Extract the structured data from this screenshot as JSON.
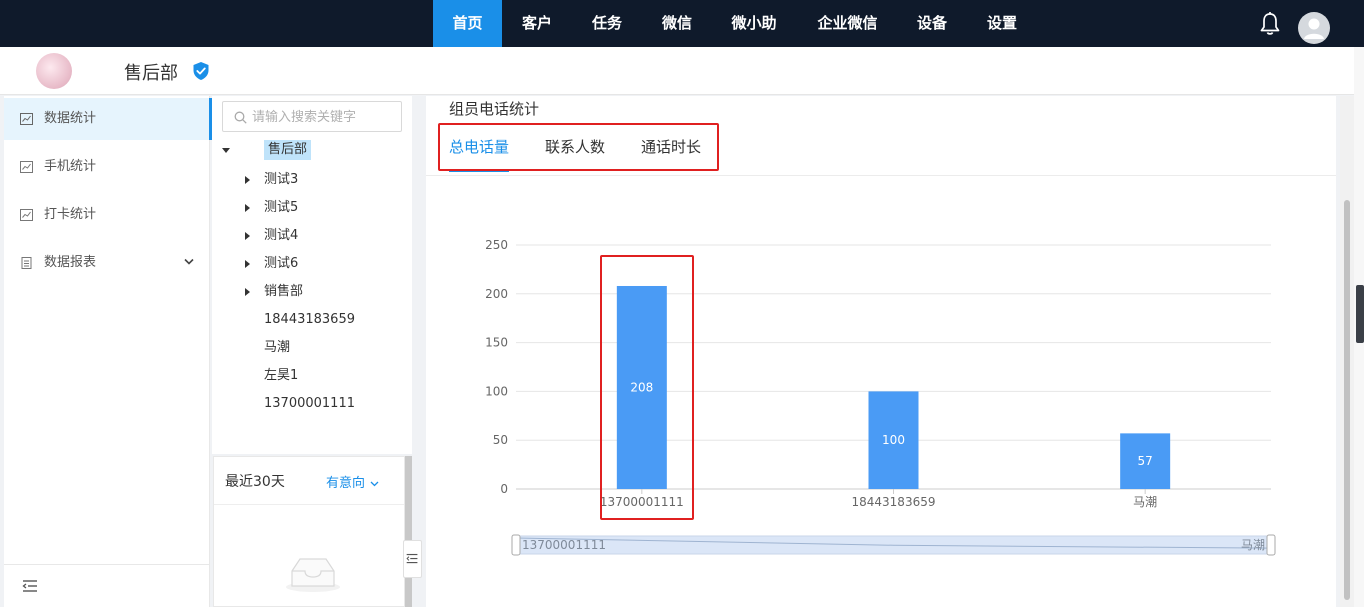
{
  "topnav": {
    "items": [
      "首页",
      "客户",
      "任务",
      "微信",
      "微小助",
      "企业微信",
      "设备",
      "设置"
    ],
    "active_index": 0,
    "accent": "#1a8fe8",
    "background": "#0f1a2b"
  },
  "org": {
    "name": "售后部",
    "verified_icon": "shield-check-icon"
  },
  "leftmenu": {
    "items": [
      {
        "label": "数据统计",
        "icon": "chart-icon",
        "active": true
      },
      {
        "label": "手机统计",
        "icon": "chart-icon",
        "active": false
      },
      {
        "label": "打卡统计",
        "icon": "chart-icon",
        "active": false
      },
      {
        "label": "数据报表",
        "icon": "table-icon",
        "active": false,
        "expandable": true
      }
    ]
  },
  "tree": {
    "search_placeholder": "请输入搜索关键字",
    "root": "售后部",
    "children": [
      "测试3",
      "测试5",
      "测试4",
      "测试6",
      "销售部"
    ],
    "members": [
      "18443183659",
      "马潮",
      "左昊1",
      "13700001111"
    ]
  },
  "recent": {
    "title": "最近30天",
    "filter": "有意向"
  },
  "main": {
    "title": "组员电话统计",
    "tabs": [
      "总电话量",
      "联系人数",
      "通话时长"
    ],
    "active_tab": 0
  },
  "chart_data": {
    "type": "bar",
    "title": "",
    "xlabel": "",
    "ylabel": "",
    "categories": [
      "13700001111",
      "18443183659",
      "马潮"
    ],
    "values": [
      208,
      100,
      57
    ],
    "ylim": [
      0,
      250
    ],
    "yticks": [
      0,
      50,
      100,
      150,
      200,
      250
    ],
    "bar_color": "#4a9bf5",
    "grid": true,
    "data_zoom": {
      "start_label": "13700001111",
      "end_label": "马潮"
    }
  }
}
